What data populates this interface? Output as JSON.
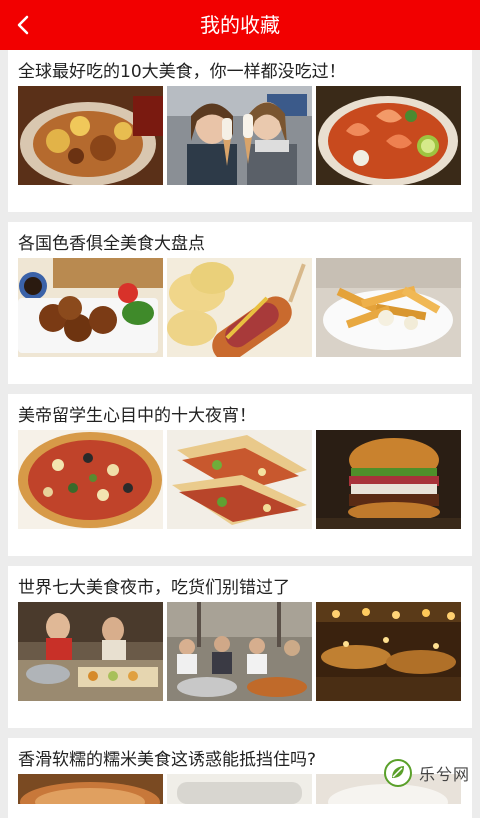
{
  "header": {
    "title": "我的收藏",
    "back_icon": "chevron-left-icon",
    "background": "#f20000"
  },
  "favorites": [
    {
      "title": "全球最好吃的10大美食，你一样都没吃过！"
    },
    {
      "title": "各国色香俱全美食大盘点"
    },
    {
      "title": "美帝留学生心目中的十大夜宵！"
    },
    {
      "title": "世界七大美食夜市，吃货们别错过了"
    },
    {
      "title": "香滑软糯的糯米美食这诱惑能抵挡住吗?"
    }
  ],
  "watermark": {
    "text": "乐兮网",
    "icon": "leaf-circle-icon"
  }
}
